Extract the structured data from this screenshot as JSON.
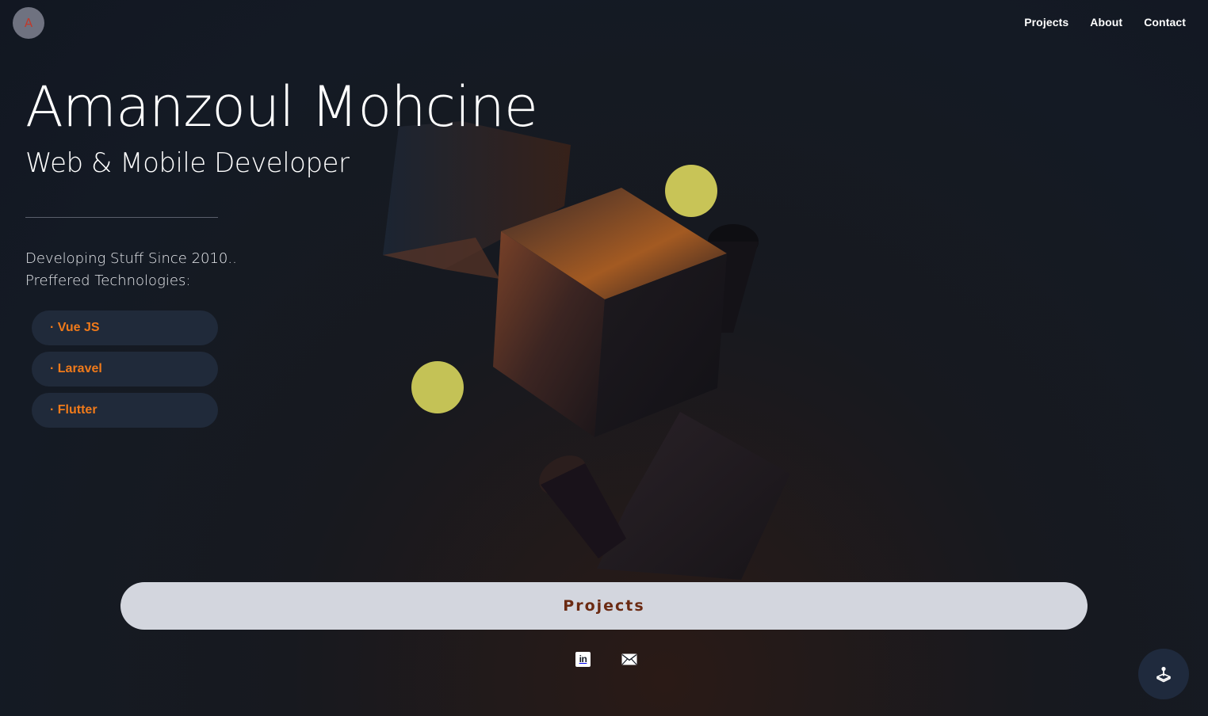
{
  "header": {
    "logo_letter": "A",
    "nav": [
      {
        "label": "Projects"
      },
      {
        "label": "About"
      },
      {
        "label": "Contact"
      }
    ]
  },
  "hero": {
    "name": "Amanzoul Mohcine",
    "role": "Web & Mobile Developer",
    "intro_line1": "Developing Stuff Since 2010..",
    "intro_line2": "Preffered Technologies:",
    "technologies": [
      {
        "label": "· Vue JS"
      },
      {
        "label": "· Laravel"
      },
      {
        "label": "· Flutter"
      }
    ]
  },
  "cta": {
    "label": "Projects"
  },
  "socials": {
    "linkedin_glyph": "in",
    "linkedin_icon": "linkedin-icon",
    "email_icon": "mail-icon"
  },
  "fab": {
    "icon": "joystick-icon"
  },
  "colors": {
    "background": "#141a24",
    "accent": "#f07a1a",
    "pill_bg": "#202a3a",
    "cta_bg": "#d3d6de",
    "cta_text": "#6b2a12",
    "sphere": "#c8c457"
  }
}
